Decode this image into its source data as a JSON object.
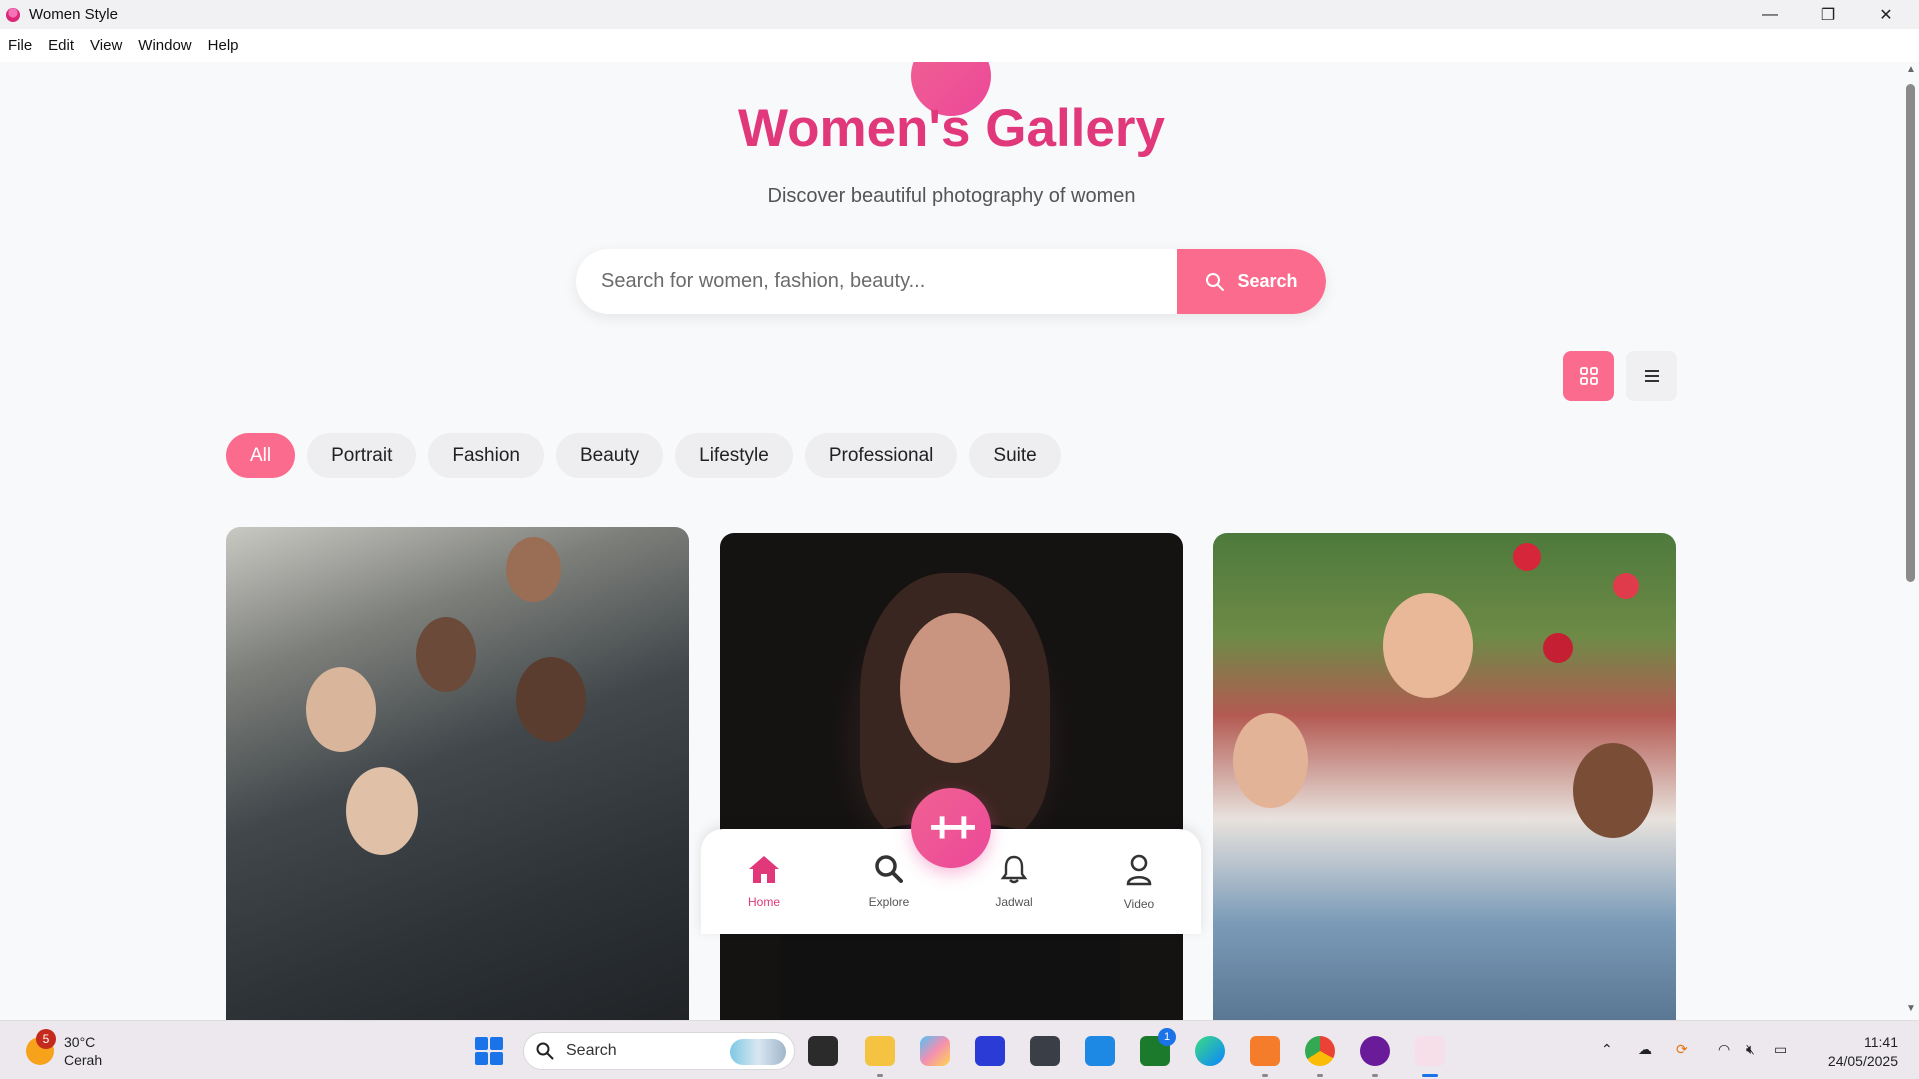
{
  "window": {
    "title": "Women Style",
    "controls": {
      "minimize": "—",
      "maximize": "❐",
      "close": "✕"
    }
  },
  "menu": [
    "File",
    "Edit",
    "View",
    "Window",
    "Help"
  ],
  "header": {
    "title": "Women's Gallery",
    "subtitle": "Discover beautiful photography of women"
  },
  "search": {
    "placeholder": "Search for women, fashion, beauty...",
    "value": "",
    "button_label": "Search"
  },
  "view_toggle": {
    "active": "grid",
    "options": [
      "grid",
      "list"
    ]
  },
  "filters": {
    "active": "All",
    "items": [
      "All",
      "Portrait",
      "Fashion",
      "Beauty",
      "Lifestyle",
      "Professional",
      "Suite"
    ]
  },
  "gallery": {
    "cards": [
      {
        "subject": "group-of-women-photo"
      },
      {
        "subject": "portrait-woman-photo"
      },
      {
        "subject": "women-in-tulip-garden-photo"
      }
    ]
  },
  "bottom_nav": {
    "fab_label": "++",
    "items": [
      {
        "label": "Home",
        "icon": "home-icon",
        "active": true
      },
      {
        "label": "Explore",
        "icon": "search-icon",
        "active": false
      },
      {
        "label": "Jadwal",
        "icon": "bell-icon",
        "active": false
      },
      {
        "label": "Video",
        "icon": "user-icon",
        "active": false
      }
    ]
  },
  "colors": {
    "accent": "#fb6b8d",
    "title_pink": "#e0387a",
    "background": "#f8f9fb"
  },
  "taskbar": {
    "weather": {
      "temp": "30°C",
      "condition": "Cerah",
      "badge": "5"
    },
    "search_label": "Search",
    "time": "11:41",
    "date": "24/05/2025",
    "notification_badge": "1"
  }
}
